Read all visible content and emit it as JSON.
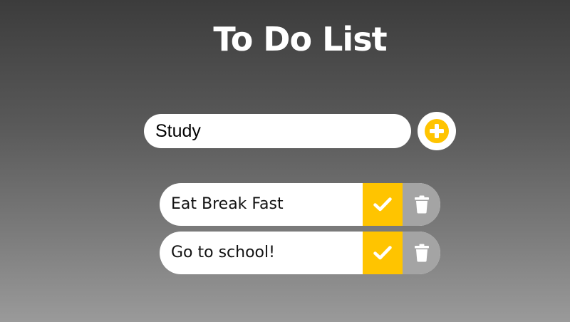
{
  "app": {
    "title": "To Do List"
  },
  "input": {
    "value": "Study"
  },
  "todos": [
    {
      "text": "Eat Break Fast"
    },
    {
      "text": "Go to school!"
    }
  ],
  "icons": {
    "add": "plus-circle-icon",
    "complete": "check-icon",
    "delete": "trash-icon"
  },
  "colors": {
    "accent": "#ffc400",
    "delete_bg": "#a4a4a4"
  }
}
